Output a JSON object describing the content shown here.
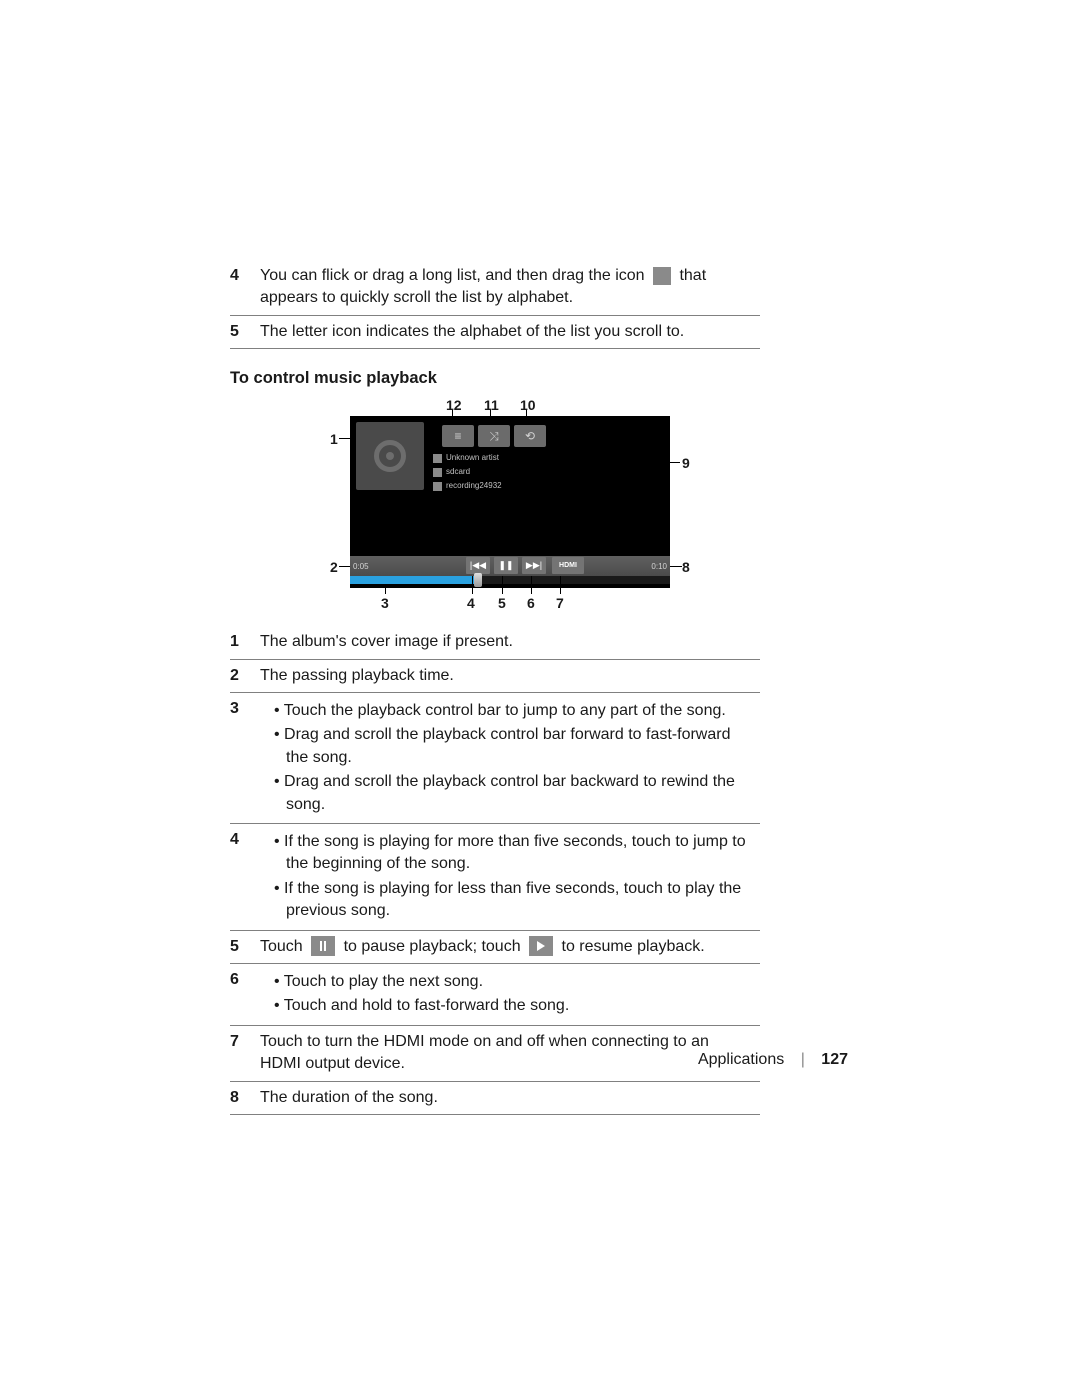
{
  "prior_steps": [
    {
      "num": "4",
      "parts": [
        {
          "t": "text",
          "v": "You can flick or drag a long list, and then drag the icon "
        },
        {
          "t": "thumb"
        },
        {
          "t": "text",
          "v": " that appears to quickly scroll the list by alphabet."
        }
      ]
    },
    {
      "num": "5",
      "text": "The letter icon indicates the alphabet of the list you scroll to."
    }
  ],
  "section_title": "To control music playback",
  "figure": {
    "meta_lines": [
      "Unknown artist",
      "sdcard",
      "recording24932"
    ],
    "time_left": "0:05",
    "time_right": "0:10",
    "hdmi_label": "HDMI",
    "callouts_top": [
      "12",
      "11",
      "10"
    ],
    "callout_left1": "1",
    "callout_left2": "2",
    "callout_right1": "9",
    "callout_right2": "8",
    "callouts_bottom": [
      "3",
      "4",
      "5",
      "6",
      "7"
    ]
  },
  "steps2": {
    "r1": {
      "num": "1",
      "text": "The album's cover image if present."
    },
    "r2": {
      "num": "2",
      "text": "The passing playback time."
    },
    "r3": {
      "num": "3",
      "bul": [
        "Touch the playback control bar to jump to any part of the song.",
        "Drag and scroll the playback control bar forward to fast-forward the song.",
        "Drag and scroll the playback control bar backward to rewind the song."
      ]
    },
    "r4": {
      "num": "4",
      "bul": [
        "If the song is playing for more than five seconds, touch to jump to the beginning of the song.",
        "If the song is playing for less than five seconds, touch to play the previous song."
      ]
    },
    "r5": {
      "num": "5",
      "parts": [
        {
          "t": "text",
          "v": "Touch "
        },
        {
          "t": "pause"
        },
        {
          "t": "text",
          "v": " to pause playback; touch "
        },
        {
          "t": "play"
        },
        {
          "t": "text",
          "v": " to resume playback."
        }
      ]
    },
    "r6": {
      "num": "6",
      "bul": [
        "Touch to play the next song.",
        "Touch and hold to fast-forward the song."
      ]
    },
    "r7": {
      "num": "7",
      "text": "Touch to turn the HDMI mode on and off when connecting to an HDMI output device."
    },
    "r8": {
      "num": "8",
      "text": "The duration of the song."
    }
  },
  "footer": {
    "section": "Applications",
    "page": "127"
  }
}
